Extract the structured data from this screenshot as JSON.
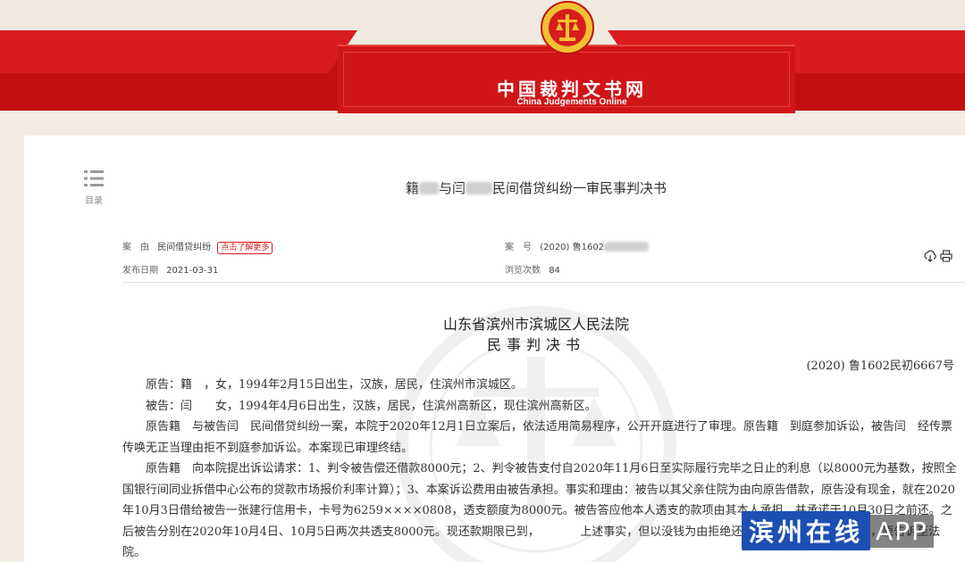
{
  "header": {
    "site_title": "中国裁判文书网",
    "site_subtitle": "China Judgements Online"
  },
  "toc": {
    "label": "目录"
  },
  "document": {
    "title_parts": [
      "籍",
      "与闫",
      "民间借贷纠纷一审民事判决书"
    ],
    "case_cause_label": "案　由",
    "case_cause_value": "民间借贷纠纷",
    "more_button": "点击了解更多",
    "case_number_label": "案　号",
    "case_number_value": "(2020) 鲁1602",
    "publish_date_label": "发布日期",
    "publish_date_value": "2021-03-31",
    "views_label": "浏览次数",
    "views_value": "84",
    "court_name": "山东省滨州市滨城区人民法院",
    "doc_type": "民事判决书",
    "full_case_number": "(2020) 鲁1602民初6667号",
    "paragraphs": [
      "原告：籍　，女，1994年2月15日出生，汉族，居民，住滨州市滨城区。",
      "被告：闫　　女，1994年4月6日出生，汉族，居民，住滨州高新区，现住滨州高新区。",
      "原告籍　与被告闫　民间借贷纠纷一案，本院于2020年12月1日立案后，依法适用简易程序，公开开庭进行了审理。原告籍　到庭参加诉讼，被告闫　经传票传唤无正当理由拒不到庭参加诉讼。本案现已审理终结。",
      "原告籍　向本院提出诉讼请求：1、判令被告偿还借款8000元；2、判令被告支付自2020年11月6日至实际履行完毕之日止的利息（以8000元为基数，按照全国银行间同业拆借中心公布的贷款市场报价利率计算）；3、本案诉讼费用由被告承担。事实和理由：被告以其父亲住院为由向原告借款，原告没有现金，就在2020年10月3日借给被告一张建行信用卡，卡号为6259××××0808，透支额度为8000元。被告答应他本人透支的款项由其本人承担，并承诺于10月30日之前还。之后被告分别在2020年10月4日、10月5日两次共透支8000元。现还款期限已到，　　　　上述事实，但以没钱为由拒绝还款。为维护自身合法权益，原告诉至法院。"
    ]
  },
  "app_watermark": {
    "brand": "滨州在线",
    "suffix": "APP"
  },
  "icons": {
    "toc": "list-icon",
    "download": "download-icon",
    "print": "print-icon",
    "emblem": "court-emblem-icon"
  },
  "colors": {
    "brand_red": "#c40f12",
    "accent_red": "#d81c1f",
    "app_blue": "#1d4fb3"
  }
}
